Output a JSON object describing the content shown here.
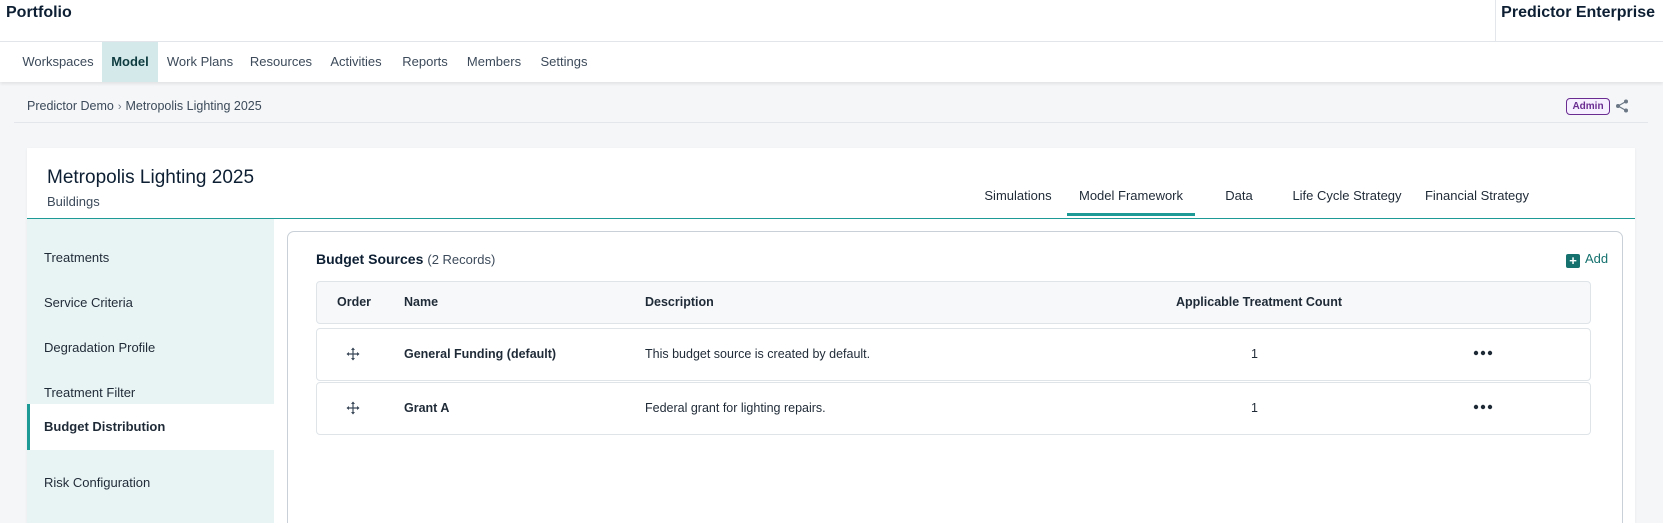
{
  "header": {
    "app_title": "Portfolio",
    "brand": "Predictor Enterprise"
  },
  "nav": {
    "items": [
      {
        "label": "Workspaces"
      },
      {
        "label": "Model",
        "active": true
      },
      {
        "label": "Work Plans"
      },
      {
        "label": "Resources"
      },
      {
        "label": "Activities"
      },
      {
        "label": "Reports"
      },
      {
        "label": "Members"
      },
      {
        "label": "Settings"
      }
    ]
  },
  "breadcrumb": {
    "items": [
      "Predictor Demo",
      "Metropolis Lighting 2025"
    ],
    "separator": "›"
  },
  "role_badge": "Admin",
  "model": {
    "title": "Metropolis Lighting 2025",
    "subtitle": "Buildings",
    "tabs": [
      {
        "label": "Simulations"
      },
      {
        "label": "Model Framework",
        "active": true
      },
      {
        "label": "Data"
      },
      {
        "label": "Life Cycle Strategy"
      },
      {
        "label": "Financial Strategy"
      }
    ]
  },
  "side_menu": {
    "items": [
      {
        "label": "Treatments"
      },
      {
        "label": "Service Criteria"
      },
      {
        "label": "Degradation Profile"
      },
      {
        "label": "Treatment Filter"
      },
      {
        "label": "Budget Distribution",
        "active": true
      },
      {
        "label": "Risk Configuration"
      }
    ]
  },
  "budget": {
    "title": "Budget Sources",
    "count_text": "(2 Records)",
    "add_label": "Add",
    "add_symbol": "+",
    "columns": [
      "Order",
      "Name",
      "Description",
      "Applicable Treatment Count"
    ],
    "rows": [
      {
        "name": "General Funding (default)",
        "description": "This budget source is created by default.",
        "count": "1"
      },
      {
        "name": "Grant A",
        "description": "Federal grant for lighting repairs.",
        "count": "1"
      }
    ]
  },
  "colors": {
    "accent": "#1e9a96",
    "nav_active_bg": "#d4eaea",
    "side_bg": "#e8f4f4",
    "badge": "#6a2c91",
    "add": "#14716e"
  },
  "icons": {
    "share": "share-icon",
    "drag": "drag-move-icon",
    "more": "more-horizontal-icon",
    "add": "plus-square-icon"
  }
}
